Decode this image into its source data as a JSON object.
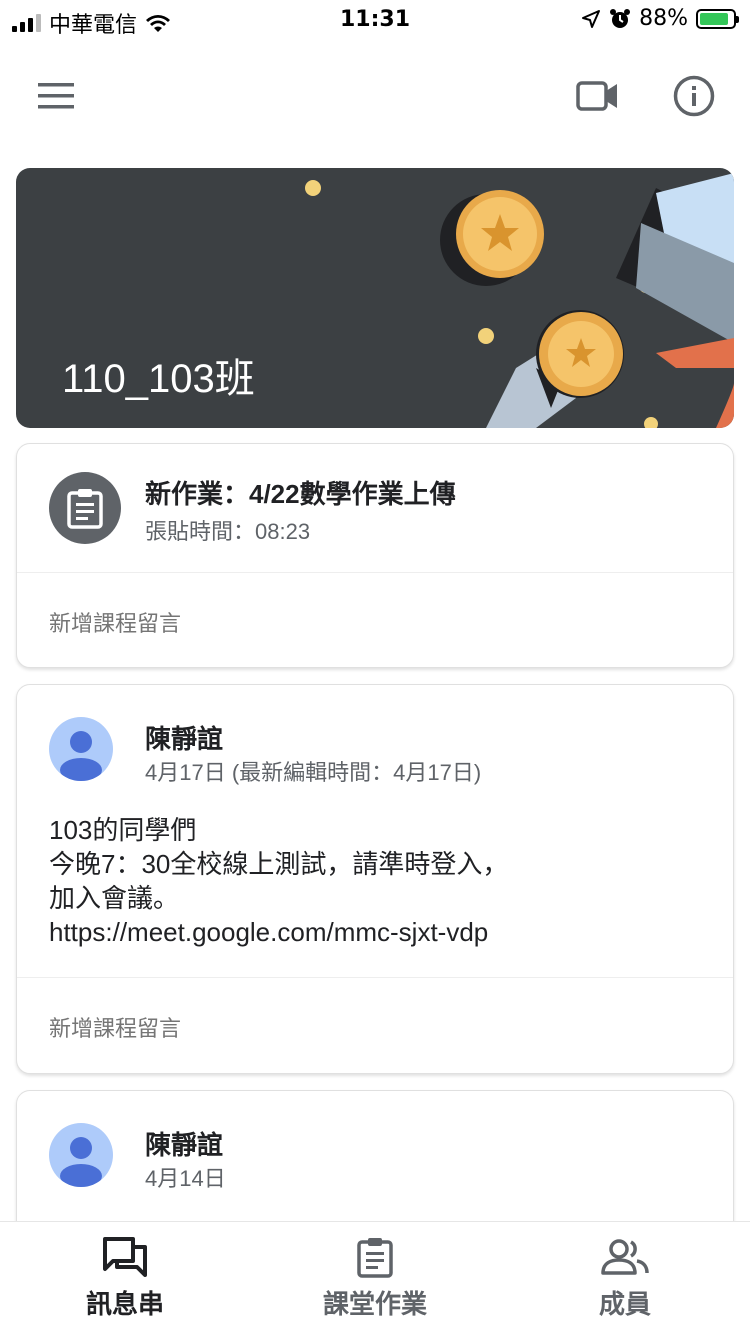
{
  "status_bar": {
    "carrier": "中華電信",
    "time": "11:31",
    "battery_percent": "88%",
    "battery_level": 0.88
  },
  "app_bar": {
    "menu_icon": "hamburger-menu-icon",
    "video_icon": "video-camera-icon",
    "info_icon": "info-icon"
  },
  "banner": {
    "class_name": "110_103班",
    "background_color": "#3c4043"
  },
  "posts": [
    {
      "type": "assignment",
      "title": "新作業：4/22數學作業上傳",
      "posted_time": "張貼時間：08:23",
      "add_comment": "新增課程留言"
    },
    {
      "type": "announcement",
      "author": "陳靜誼",
      "date": "4月17日 (最新編輯時間：4月17日)",
      "body_lines": [
        "103的同學們",
        "今晚7：30全校線上測試，請準時登入，",
        "加入會議。",
        "https://meet.google.com/mmc-sjxt-vdp"
      ],
      "add_comment": "新增課程留言"
    },
    {
      "type": "announcement",
      "author": "陳靜誼",
      "date": "4月14日"
    }
  ],
  "bottom_nav": {
    "items": [
      {
        "label": "訊息串",
        "icon": "stream-icon",
        "active": true
      },
      {
        "label": "課堂作業",
        "icon": "classwork-icon",
        "active": false
      },
      {
        "label": "成員",
        "icon": "people-icon",
        "active": false
      }
    ]
  },
  "colors": {
    "accent": "#202124",
    "secondary_text": "#5f6368",
    "avatar_bg": "#aecbfa",
    "avatar_fg": "#4a6fd6"
  }
}
